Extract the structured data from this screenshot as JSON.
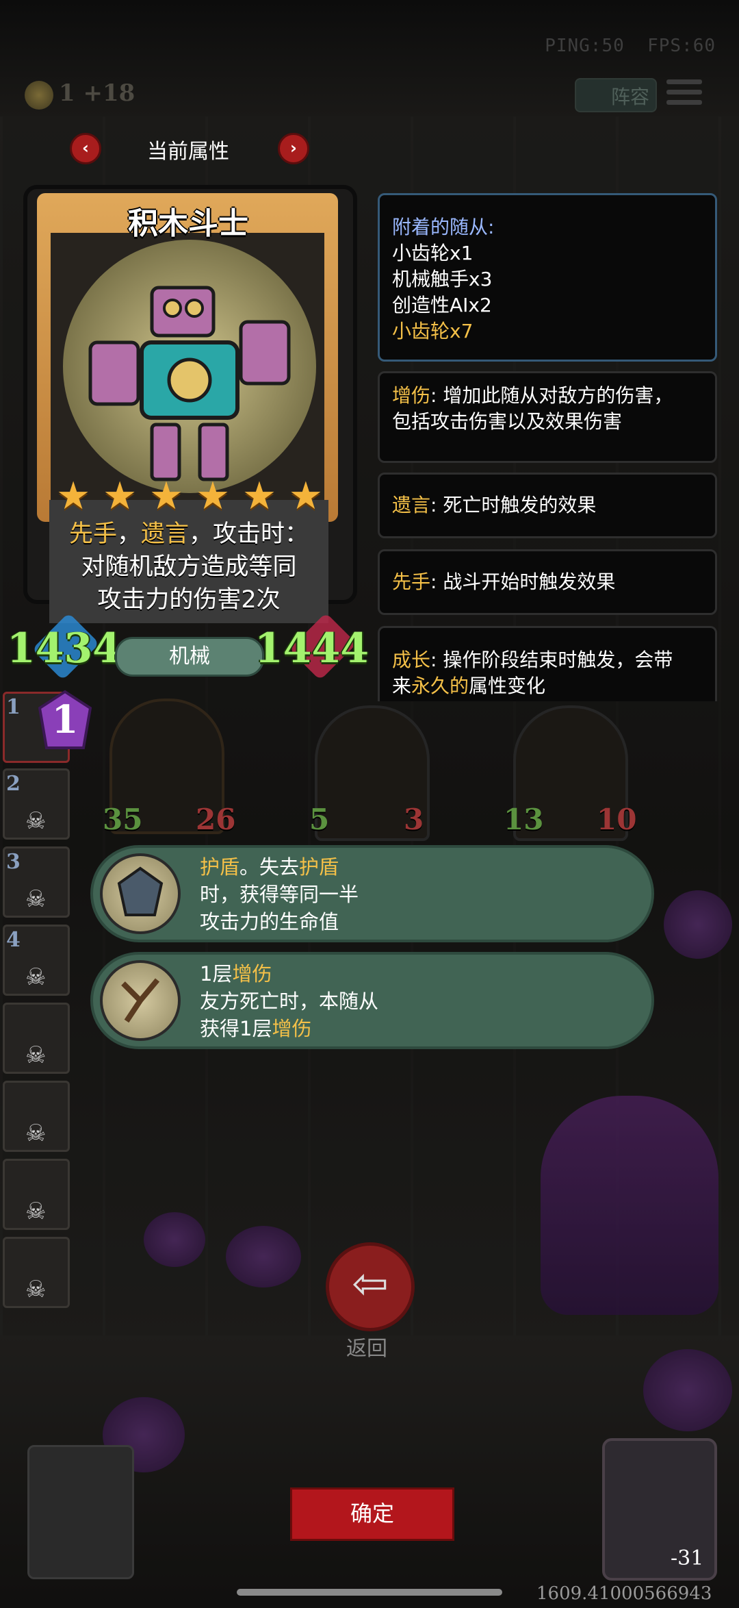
{
  "hud": {
    "ping": "PING:50",
    "fps": "FPS:60",
    "gold": "1",
    "gold_income": "+18",
    "lineup_label": "阵容"
  },
  "attr_nav": {
    "title": "当前属性",
    "prev": "‹",
    "next": "›"
  },
  "card": {
    "name": "积木斗士",
    "stars": "★★★★★★",
    "keyword_1": "先手",
    "sep": "，",
    "keyword_2": "遗言",
    "text_1": "，攻击时：",
    "text_2": "对随机敌方造成等同",
    "text_3": "攻击力的伤害2次",
    "attack": "1434",
    "health": "1444",
    "tribe": "机械"
  },
  "attached": {
    "heading": "附着的随从:",
    "items": [
      "小齿轮x1",
      "机械触手x3",
      "创造性AIx2"
    ],
    "highlight_item": "小齿轮x7"
  },
  "keywords": [
    {
      "term": "增伤",
      "desc": ": 增加此随从对敌方的伤害，",
      "desc2": "包括攻击伤害以及效果伤害"
    },
    {
      "term": "遗言",
      "desc": ": 死亡时触发的效果"
    },
    {
      "term": "先手",
      "desc": ": 战斗开始时触发效果"
    },
    {
      "term": "成长",
      "desc": ": 操作阶段结束时触发，会带",
      "desc2a": "来",
      "desc2b": "永久的",
      "desc2c": "属性变化"
    }
  ],
  "tier": {
    "current": "1"
  },
  "sidebar": {
    "slots": [
      "1",
      "2",
      "3",
      "4",
      "",
      "",
      "",
      ""
    ]
  },
  "board_minions": [
    {
      "attack": "35",
      "health": "26"
    },
    {
      "attack": "5",
      "health": "3"
    },
    {
      "attack": "13",
      "health": "10"
    }
  ],
  "tooltips": [
    {
      "line1_a": "护盾",
      "line1_b": "。失去",
      "line1_c": "护盾",
      "line2": "时，获得等同一半",
      "line3": "攻击力的生命值"
    },
    {
      "line1_a": "1层",
      "line1_b": "增伤",
      "line2": "友方死亡时，本随从",
      "line3_a": "获得1层",
      "line3_b": "增伤"
    }
  ],
  "buttons": {
    "back_label": "返回",
    "back_icon": "⇦",
    "confirm_label": "确定"
  },
  "hero": {
    "hp": "-31"
  },
  "footer": {
    "coord": "1609.41000566943"
  },
  "colors": {
    "highlight": "#f4c048",
    "stat_green": "#a3f26e",
    "button_red": "#b3161c",
    "tooltip_bg": "#416454"
  }
}
